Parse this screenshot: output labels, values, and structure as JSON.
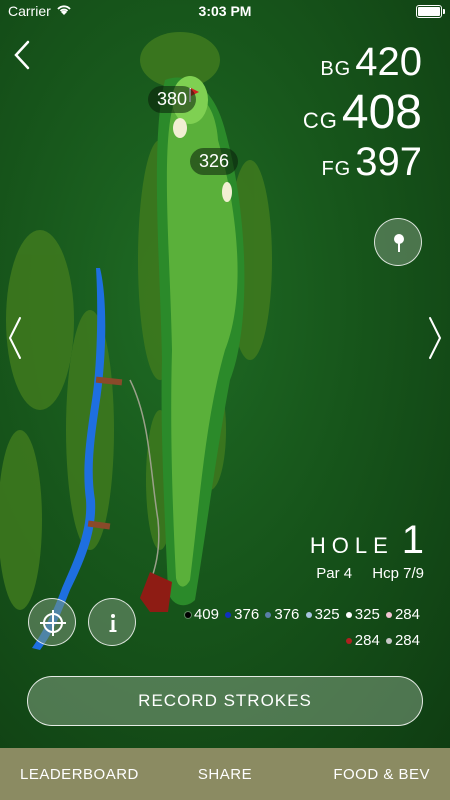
{
  "status_bar": {
    "carrier": "Carrier",
    "time": "3:03 PM"
  },
  "distances": [
    {
      "label": "BG",
      "value": "420"
    },
    {
      "label": "CG",
      "value": "408"
    },
    {
      "label": "FG",
      "value": "397"
    }
  ],
  "map_markers": [
    {
      "value": "380"
    },
    {
      "value": "326"
    }
  ],
  "hole": {
    "word": "HOLE",
    "number": "1",
    "par": "Par 4",
    "hcp": "Hcp 7/9"
  },
  "tees": [
    {
      "yards": "409",
      "color": "#000000"
    },
    {
      "yards": "376",
      "color": "#1030c0"
    },
    {
      "yards": "376",
      "color": "#5a7fa8"
    },
    {
      "yards": "325",
      "color": "#a8c4e0"
    },
    {
      "yards": "325",
      "color": "#ffffff"
    },
    {
      "yards": "284",
      "color": "#f4c6d4"
    },
    {
      "yards": "284",
      "color": "#b02020"
    },
    {
      "yards": "284",
      "color": "#c8c8c8"
    }
  ],
  "record_button": "RECORD STROKES",
  "tabs": [
    {
      "label": "LEADERBOARD"
    },
    {
      "label": "SHARE"
    },
    {
      "label": "FOOD & BEV"
    }
  ],
  "colors": {
    "tabbar": "#8b8b62",
    "fairway": "#5ab03a",
    "water": "#1e6fe0"
  }
}
